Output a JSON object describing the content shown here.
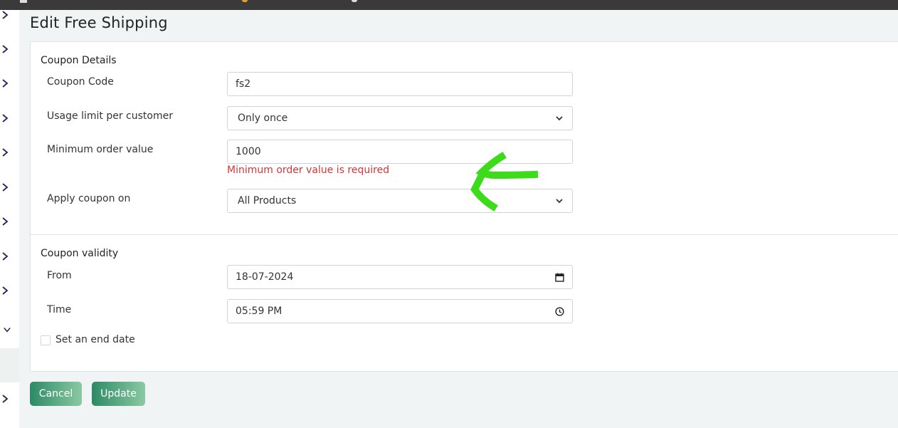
{
  "page_title": "Edit Free Shipping",
  "sections": {
    "details_title": "Coupon Details",
    "validity_title": "Coupon validity"
  },
  "fields": {
    "coupon_code": {
      "label": "Coupon Code",
      "value": "fs2"
    },
    "usage_limit": {
      "label": "Usage limit per customer",
      "value": "Only once"
    },
    "min_order": {
      "label": "Minimum order value",
      "value": "1000",
      "error": "Minimum order value is required"
    },
    "apply_on": {
      "label": "Apply coupon on",
      "value": "All Products"
    },
    "from": {
      "label": "From",
      "value": "18-07-2024"
    },
    "time": {
      "label": "Time",
      "value": "05:59 PM"
    },
    "end_date": {
      "label": "Set an end date",
      "checked": false
    }
  },
  "buttons": {
    "cancel": "Cancel",
    "update": "Update"
  },
  "colors": {
    "error": "#d0363a",
    "annotation_arrow": "#3ddc1a",
    "button_start": "#2c8a66",
    "button_end": "#8ac9a2",
    "sidebar_chevron": "#2a2060"
  },
  "icons": {
    "sidebar": "chevron-right-icon",
    "sidebar_open": "chevron-down-icon",
    "select": "chevron-down-icon",
    "date": "calendar-icon",
    "time": "clock-icon"
  }
}
